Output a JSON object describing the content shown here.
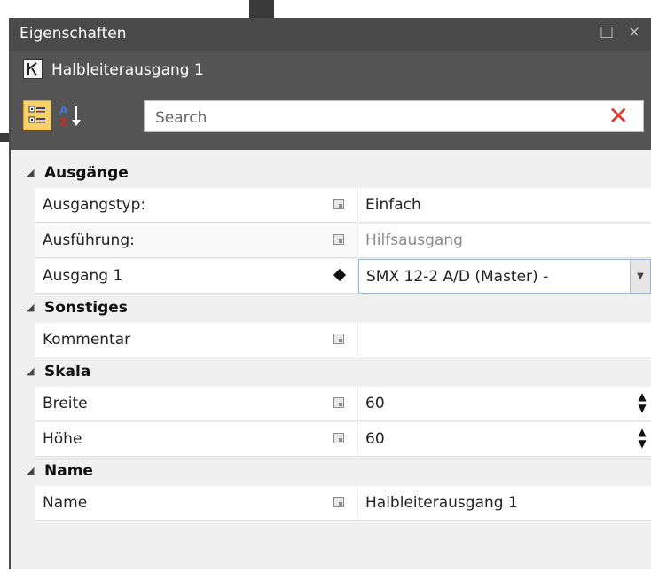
{
  "window": {
    "title": "Eigenschaften",
    "buttons": {
      "restore": "□",
      "close": "×"
    }
  },
  "object": {
    "name": "Halbleiterausgang 1",
    "icon": "relay-output-icon"
  },
  "toolbar": {
    "categorized_icon": "categorized-view-icon",
    "alphabetical_icon": "sort-az-icon",
    "search_placeholder": "Search",
    "clear_icon": "clear-x-icon",
    "accent": "#f6d06a"
  },
  "categories": [
    {
      "name": "Ausgänge",
      "props": [
        {
          "label": "Ausgangstyp:",
          "value": "Einfach",
          "indicator": "square"
        },
        {
          "label": "Ausführung:",
          "value": "Hilfsausgang",
          "indicator": "square",
          "readonly": true
        },
        {
          "label": "Ausgang 1",
          "value": "SMX 12-2 A/D (Master) -",
          "indicator": "diamond",
          "editor": "dropdown"
        }
      ]
    },
    {
      "name": "Sonstiges",
      "props": [
        {
          "label": "Kommentar",
          "value": "",
          "indicator": "square"
        }
      ]
    },
    {
      "name": "Skala",
      "props": [
        {
          "label": "Breite",
          "value": "60",
          "indicator": "square",
          "editor": "spinner"
        },
        {
          "label": "Höhe",
          "value": "60",
          "indicator": "square",
          "editor": "spinner"
        }
      ]
    },
    {
      "name": "Name",
      "props": [
        {
          "label": "Name",
          "value": "Halbleiterausgang 1",
          "indicator": "square"
        }
      ]
    }
  ]
}
